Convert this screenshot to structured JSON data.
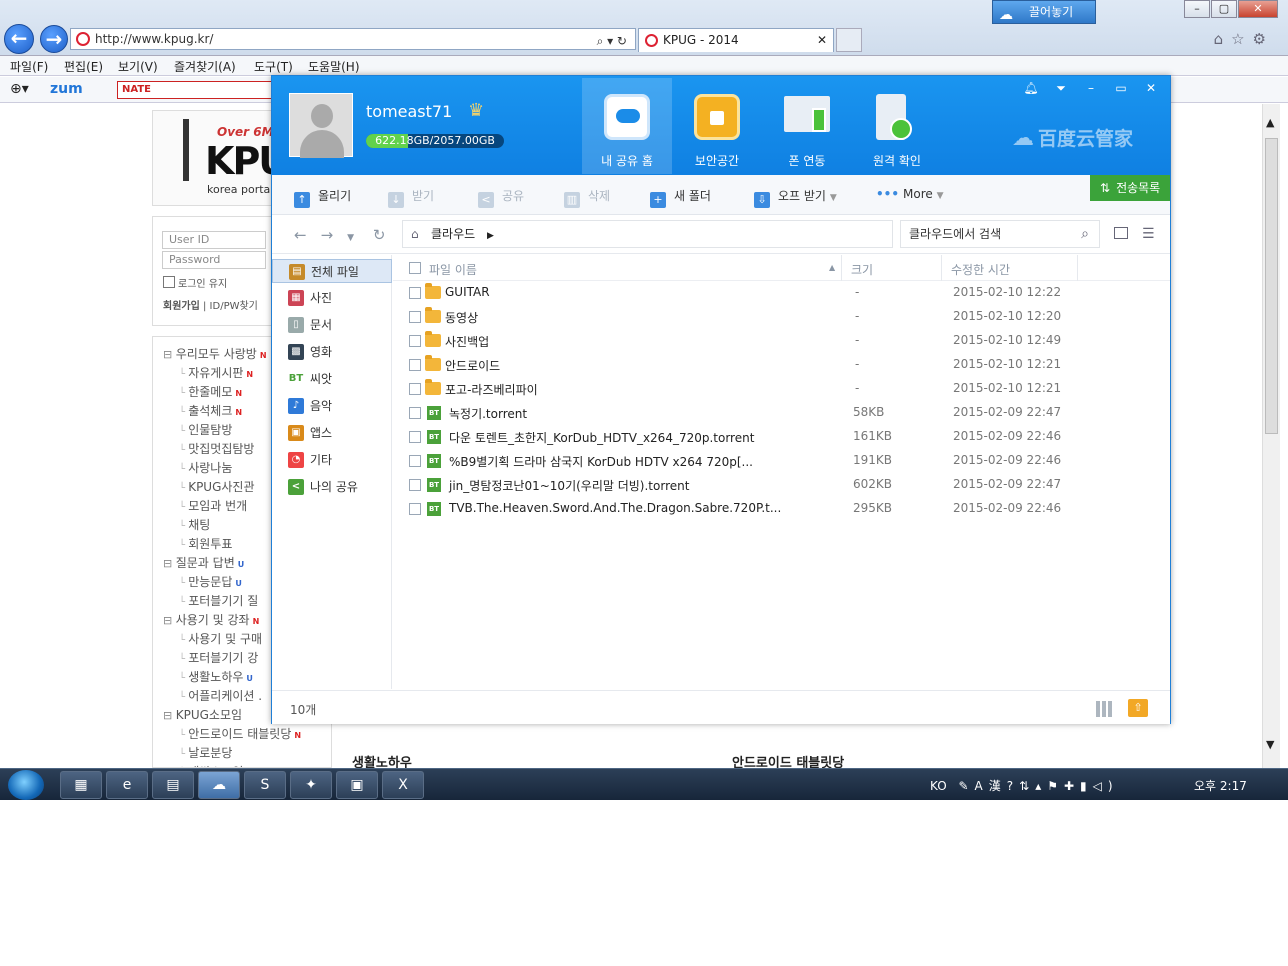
{
  "browser": {
    "address": "http://www.kpug.kr/",
    "tab_title": "KPUG - 2014",
    "cloud_button": "끌어놓기",
    "menu": [
      "파일(F)",
      "편집(E)",
      "보기(V)",
      "즐겨찾기(A)",
      "도구(T)",
      "도움말(H)"
    ],
    "fav": {
      "zum": "zum",
      "nate": "NATE"
    }
  },
  "site": {
    "logo_over": "Over 6M",
    "logo_text": "KPU",
    "logo_sub": "korea portab",
    "login": {
      "user_placeholder": "User ID",
      "pass_placeholder": "Password",
      "keep": "로그인 유지",
      "join": "회원가입",
      "find": "ID/PW찾기"
    },
    "tree": [
      {
        "label": "우리모두 사랑방",
        "type": "top",
        "flag": "N"
      },
      {
        "label": "자유게시판",
        "type": "sub",
        "flag": "N"
      },
      {
        "label": "한줄메모",
        "type": "sub",
        "flag": "N"
      },
      {
        "label": "출석체크",
        "type": "sub",
        "flag": "N"
      },
      {
        "label": "인물탐방",
        "type": "sub",
        "flag": ""
      },
      {
        "label": "맛집멋집탐방",
        "type": "sub",
        "flag": ""
      },
      {
        "label": "사랑나눔",
        "type": "sub",
        "flag": ""
      },
      {
        "label": "KPUG사진관",
        "type": "sub",
        "flag": ""
      },
      {
        "label": "모임과 번개",
        "type": "sub",
        "flag": ""
      },
      {
        "label": "채팅",
        "type": "sub",
        "flag": ""
      },
      {
        "label": "회원투표",
        "type": "sub",
        "flag": ""
      },
      {
        "label": "질문과 답변",
        "type": "top",
        "flag": "U"
      },
      {
        "label": "만능문답",
        "type": "sub",
        "flag": "U"
      },
      {
        "label": "포터블기기 질",
        "type": "sub",
        "flag": ""
      },
      {
        "label": "사용기 및 강좌",
        "type": "top",
        "flag": "N"
      },
      {
        "label": "사용기 및 구매",
        "type": "sub",
        "flag": ""
      },
      {
        "label": "포터블기기 강",
        "type": "sub",
        "flag": ""
      },
      {
        "label": "생활노하우",
        "type": "sub",
        "flag": "U"
      },
      {
        "label": "어플리케이션 .",
        "type": "sub",
        "flag": ""
      },
      {
        "label": "KPUG소모임",
        "type": "top",
        "flag": ""
      },
      {
        "label": "안드로이드 태블릿당",
        "type": "sub",
        "flag": "N"
      },
      {
        "label": "날로분당",
        "type": "sub",
        "flag": ""
      },
      {
        "label": "새싹소모임",
        "type": "sub",
        "flag": ""
      }
    ],
    "section_left": "생활노하우",
    "section_right": "안드로이드 태블릿당"
  },
  "app": {
    "username": "tomeast71",
    "quota_text": "622.18GB/2057.00GB",
    "quota_used": 622.18,
    "quota_total": 2057.0,
    "tabs": [
      {
        "label": "내 공유 홈",
        "icon": "cloud-icon"
      },
      {
        "label": "보안공간",
        "icon": "lock-icon"
      },
      {
        "label": "폰 연동",
        "icon": "monitor-phone-icon"
      },
      {
        "label": "원격 확인",
        "icon": "remote-sync-icon"
      }
    ],
    "brand": "百度云管家",
    "toolbar": [
      {
        "label": "올리기",
        "enabled": true
      },
      {
        "label": "받기",
        "enabled": false
      },
      {
        "label": "공유",
        "enabled": false
      },
      {
        "label": "삭제",
        "enabled": false
      },
      {
        "label": "새 폴더",
        "enabled": true
      },
      {
        "label": "오프 받기",
        "enabled": true
      },
      {
        "label": "More",
        "enabled": true
      }
    ],
    "transfer": "전송목록",
    "breadcrumb": "클라우드",
    "search_placeholder": "클라우드에서 검색",
    "sidebar": [
      {
        "label": "전체 파일",
        "icon": "folder-all-icon"
      },
      {
        "label": "사진",
        "icon": "picture-icon"
      },
      {
        "label": "문서",
        "icon": "document-icon"
      },
      {
        "label": "영화",
        "icon": "film-icon"
      },
      {
        "label": "씨앗",
        "icon": "bt-icon"
      },
      {
        "label": "음악",
        "icon": "music-icon"
      },
      {
        "label": "앱스",
        "icon": "apps-icon"
      },
      {
        "label": "기타",
        "icon": "other-icon"
      },
      {
        "label": "나의 공유",
        "icon": "share-icon"
      }
    ],
    "columns": {
      "name": "파일 이름",
      "size": "크기",
      "date": "수정한 시간"
    },
    "files": [
      {
        "name": "GUITAR",
        "kind": "folder",
        "size": "-",
        "date": "2015-02-10 12:22"
      },
      {
        "name": "동영상",
        "kind": "folder",
        "size": "-",
        "date": "2015-02-10 12:20"
      },
      {
        "name": "사진백업",
        "kind": "folder",
        "size": "-",
        "date": "2015-02-10 12:49"
      },
      {
        "name": "안드로이드",
        "kind": "folder",
        "size": "-",
        "date": "2015-02-10 12:21"
      },
      {
        "name": "포고-라즈베리파이",
        "kind": "folder",
        "size": "-",
        "date": "2015-02-10 12:21"
      },
      {
        "name": "녹정기.torrent",
        "kind": "bt",
        "size": "58KB",
        "date": "2015-02-09 22:47"
      },
      {
        "name": "다운 토렌트_초한지_KorDub_HDTV_x264_720p.torrent",
        "kind": "bt",
        "size": "161KB",
        "date": "2015-02-09 22:46"
      },
      {
        "name": "%B9별기획 드라마 삼국지 KorDub HDTV x264 720p[...",
        "kind": "bt",
        "size": "191KB",
        "date": "2015-02-09 22:46"
      },
      {
        "name": "jin_명탐정코난01~10기(우리말 더빙).torrent",
        "kind": "bt",
        "size": "602KB",
        "date": "2015-02-09 22:47"
      },
      {
        "name": "TVB.The.Heaven.Sword.And.The.Dragon.Sabre.720P.t...",
        "kind": "bt",
        "size": "295KB",
        "date": "2015-02-09 22:46"
      }
    ],
    "count": "10개"
  },
  "taskbar": {
    "tray": "KO",
    "clock": "오후 2:17"
  }
}
